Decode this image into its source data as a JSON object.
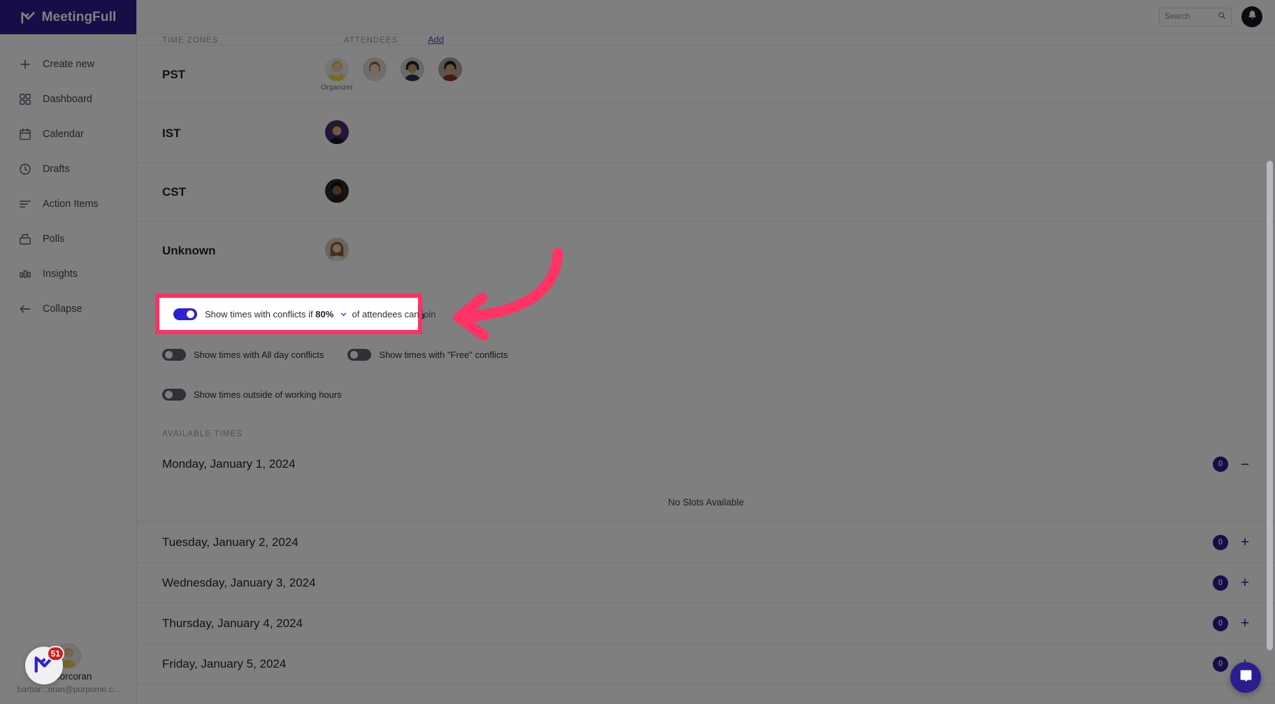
{
  "brand": {
    "name": "MeetingFull",
    "logo_icon": "meetingfull-logo-icon"
  },
  "sidebar": {
    "items": [
      {
        "label": "Create new",
        "icon": "plus-icon"
      },
      {
        "label": "Dashboard",
        "icon": "grid-icon"
      },
      {
        "label": "Calendar",
        "icon": "calendar-icon"
      },
      {
        "label": "Drafts",
        "icon": "clock-icon"
      },
      {
        "label": "Action Items",
        "icon": "list-lines-icon"
      },
      {
        "label": "Polls",
        "icon": "ballot-box-icon"
      },
      {
        "label": "Insights",
        "icon": "bar-chart-icon"
      },
      {
        "label": "Collapse",
        "icon": "arrow-left-icon"
      }
    ],
    "user": {
      "name": "a Corcoran",
      "email": "barbar...oran@purpome.c...",
      "avatar_icon": "user-avatar"
    },
    "floating_badge": {
      "count": "51",
      "icon": "meetingfull-logo-icon"
    }
  },
  "topbar": {
    "search": {
      "value": "",
      "placeholder": "Search",
      "icon": "search-icon"
    },
    "bell": {
      "icon": "bell-icon"
    }
  },
  "main": {
    "columns": {
      "time_zones": "Time Zones",
      "attendees": "Attendees",
      "add": "Add"
    },
    "timezone_rows": [
      {
        "label": "PST",
        "people": [
          {
            "role": "Organizer",
            "avatar": "avatar-blonde-yellow"
          },
          {
            "role": "",
            "avatar": "avatar-redhead"
          },
          {
            "role": "",
            "avatar": "avatar-dark-hair-man"
          },
          {
            "role": "",
            "avatar": "avatar-man-red-shirt"
          }
        ]
      },
      {
        "label": "IST",
        "people": [
          {
            "role": "",
            "avatar": "avatar-man-purple-bg"
          }
        ]
      },
      {
        "label": "CST",
        "people": [
          {
            "role": "",
            "avatar": "avatar-man-dark"
          }
        ]
      },
      {
        "label": "Unknown",
        "people": [
          {
            "role": "",
            "avatar": "avatar-woman-long-hair"
          }
        ]
      }
    ],
    "toggles": {
      "conflicts": {
        "state": "on",
        "text_before": "Show times with conflicts if",
        "percent": "80%",
        "chevron_icon": "chevron-down-icon",
        "text_after": "of attendees can join"
      },
      "all_day": {
        "state": "off",
        "label": "Show times with All day conflicts"
      },
      "free": {
        "state": "off",
        "label": "Show times with \"Free\" conflicts"
      },
      "outside_hours": {
        "state": "off",
        "label": "Show times outside of working hours"
      }
    },
    "available_times_label": "AVAILABLE TIMES",
    "days": [
      {
        "title": "Monday, January 1, 2024",
        "count": "0",
        "control": "minus-icon",
        "expanded": true,
        "empty_text": "No Slots Available"
      },
      {
        "title": "Tuesday, January 2, 2024",
        "count": "0",
        "control": "plus-icon",
        "expanded": false
      },
      {
        "title": "Wednesday, January 3, 2024",
        "count": "0",
        "control": "plus-icon",
        "expanded": false
      },
      {
        "title": "Thursday, January 4, 2024",
        "count": "0",
        "control": "plus-icon",
        "expanded": false
      },
      {
        "title": "Friday, January 5, 2024",
        "count": "0",
        "control": "plus-icon",
        "expanded": false
      }
    ]
  },
  "chat": {
    "icon": "chat-bubble-icon"
  },
  "annotation": {
    "highlight_color": "#ff2f66",
    "arrow_icon": "curved-arrow-left-icon"
  },
  "colors": {
    "brand_indigo": "#2a1d8f",
    "toggle_on": "#2d21d6",
    "accent_pink": "#ff2f66"
  }
}
